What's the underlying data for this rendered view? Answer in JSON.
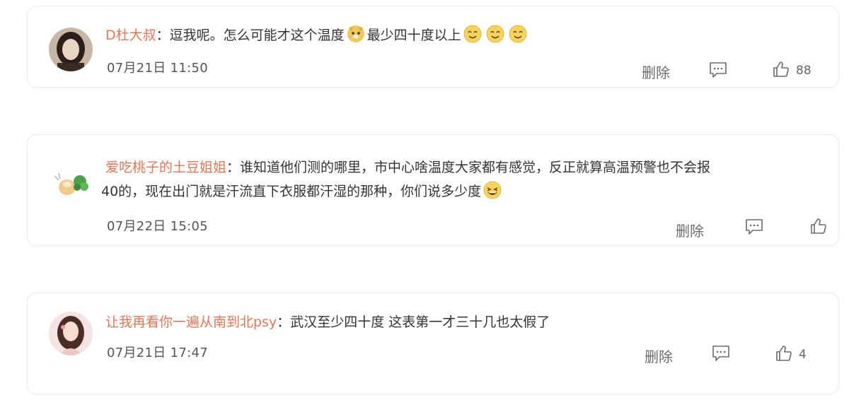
{
  "comments": [
    {
      "username": "D杜大叔",
      "separator": "：",
      "text_part1": "逗我呢。怎么可能才这个温度",
      "text_part2": "最少四十度以上",
      "timestamp": "07月21日 11:50",
      "delete_label": "删除",
      "likes": "88",
      "emojis": [
        "doge-emoji",
        "smile-emoji",
        "smile-emoji",
        "smile-emoji"
      ]
    },
    {
      "username": "爱吃桃子的土豆姐姐",
      "separator": "：",
      "text_line1": "谁知道他们测的哪里，市中心啥温度大家都有感觉，反正就算高温预警也不会报",
      "text_line2": "40的，现在出门就是汗流直下衣服都汗湿的那种，你们说多少度",
      "timestamp": "07月22日 15:05",
      "delete_label": "删除",
      "likes": "",
      "emojis": [
        "laugh-emoji"
      ]
    },
    {
      "username": "让我再看你一遍从南到北psy",
      "separator": "：",
      "text": "武汉至少四十度 这表第一才三十几也太假了",
      "timestamp": "07月21日 17:47",
      "delete_label": "删除",
      "likes": "4",
      "emojis": []
    }
  ]
}
